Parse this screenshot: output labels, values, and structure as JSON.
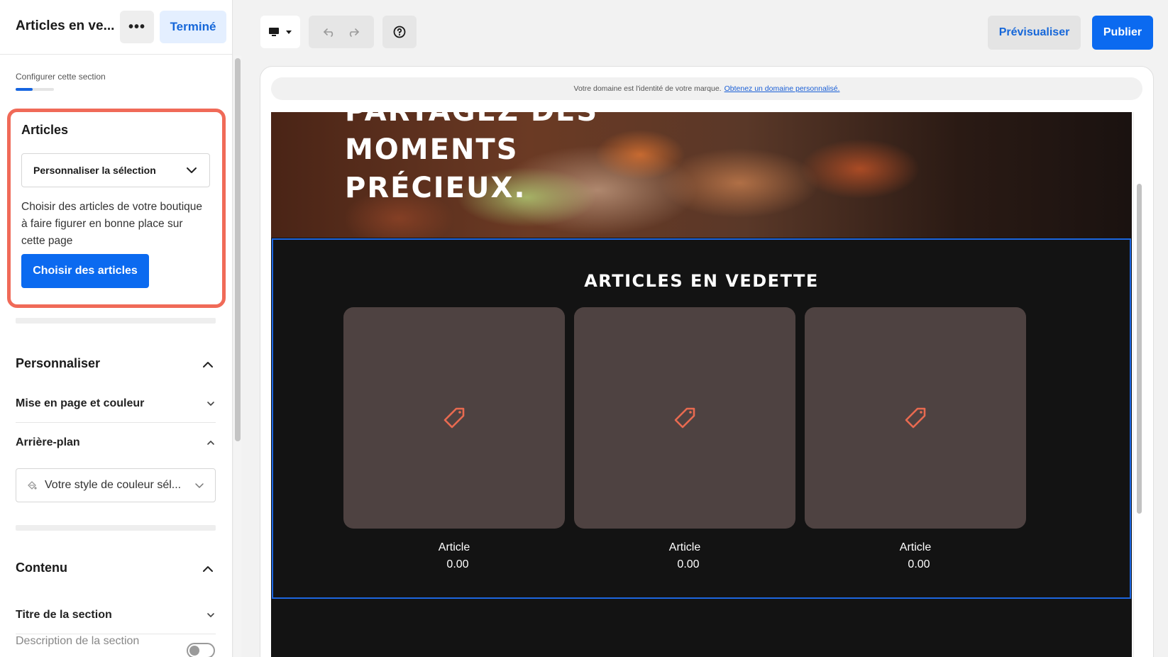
{
  "sidebar": {
    "title": "Articles en ve...",
    "more_label": "•••",
    "done_label": "Terminé",
    "subtitle": "Configurer cette section",
    "progress": 0.45,
    "articles": {
      "heading": "Articles",
      "select_value": "Personnaliser la sélection",
      "description": "Choisir des articles de votre boutique à faire figurer en bonne place sur cette page",
      "choose_button": "Choisir des articles"
    },
    "customize": {
      "heading": "Personnaliser",
      "layout_color": "Mise en page et couleur",
      "background": "Arrière-plan",
      "color_select_value": "Votre style de couleur sél..."
    },
    "content": {
      "heading": "Contenu",
      "section_title": "Titre de la section",
      "section_description": "Description de la section"
    }
  },
  "toolbar": {
    "preview_label": "Prévisualiser",
    "publish_label": "Publier"
  },
  "preview": {
    "domain_text": "Votre domaine est l'identité de votre marque.",
    "domain_link": "Obtenez un domaine personnalisé.",
    "hero_lines": [
      "PARTAGEZ DES",
      "MOMENTS",
      "PRÉCIEUX."
    ],
    "featured_title": "ARTICLES EN VEDETTE",
    "products": [
      {
        "name": "Article",
        "price": "0.00"
      },
      {
        "name": "Article",
        "price": "0.00"
      },
      {
        "name": "Article",
        "price": "0.00"
      }
    ]
  },
  "colors": {
    "accent": "#0b6af0",
    "highlight": "#f06a58",
    "site_bg": "#131313",
    "card_bg": "#4e4241"
  }
}
